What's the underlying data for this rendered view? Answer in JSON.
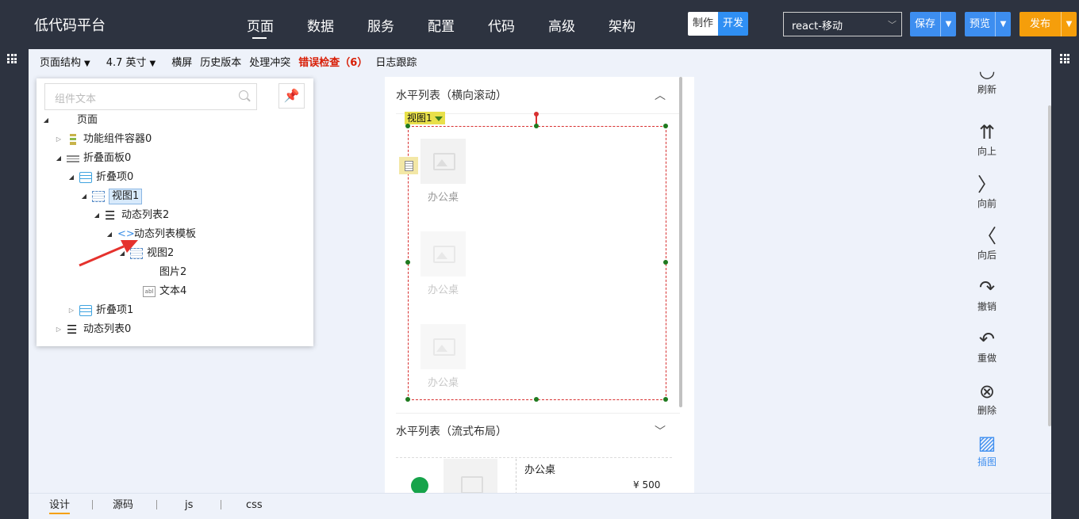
{
  "app": {
    "title": "低代码平台"
  },
  "nav": [
    {
      "label": "页面",
      "active": true
    },
    {
      "label": "数据"
    },
    {
      "label": "服务"
    },
    {
      "label": "配置"
    },
    {
      "label": "代码"
    },
    {
      "label": "高级"
    },
    {
      "label": "架构"
    }
  ],
  "mode": {
    "make": "制作",
    "dev": "开发"
  },
  "project": {
    "value": "react-移动"
  },
  "buttons": {
    "save": "保存",
    "preview": "预览",
    "publish": "发布"
  },
  "toolbar": {
    "structure": "页面结构",
    "device": "4.7 英寸",
    "landscape": "横屏",
    "history": "历史版本",
    "conflict": "处理冲突",
    "errors": "错误检查（6）",
    "log": "日志跟踪"
  },
  "tree": {
    "search_placeholder": "组件文本",
    "nodes": [
      {
        "label": "页面"
      },
      {
        "label": "功能组件容器0"
      },
      {
        "label": "折叠面板0"
      },
      {
        "label": "折叠项0"
      },
      {
        "label": "视图1",
        "selected": true
      },
      {
        "label": "动态列表2"
      },
      {
        "label": "动态列表模板"
      },
      {
        "label": "视图2"
      },
      {
        "label": "图片2"
      },
      {
        "label": "文本4"
      },
      {
        "label": "折叠项1"
      },
      {
        "label": "动态列表0"
      }
    ]
  },
  "canvas": {
    "section1_title": "水平列表（横向滚动）",
    "view_tag": "视图1",
    "cards": [
      "办公桌",
      "办公桌",
      "办公桌"
    ],
    "section2_title": "水平列表（流式布局）",
    "flow_title": "办公桌",
    "flow_price": "¥ 500"
  },
  "actions": {
    "refresh": "刷新",
    "up": "向上",
    "forward": "向前",
    "back": "向后",
    "undo": "撤销",
    "redo": "重做",
    "delete": "删除",
    "insert": "插图"
  },
  "bottom_tabs": [
    "设计",
    "源码",
    "js",
    "css"
  ],
  "colors": {
    "primary": "#3d8ef0",
    "publish": "#f59e0b",
    "error": "#d81e06",
    "topbar": "#2d3340"
  }
}
